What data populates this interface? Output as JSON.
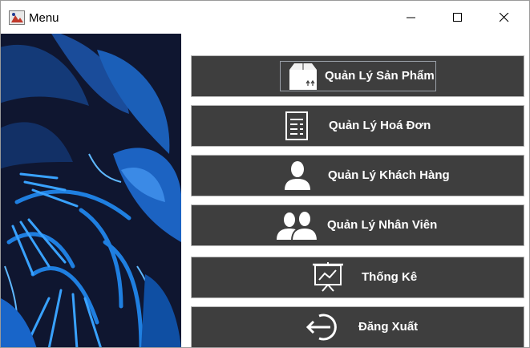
{
  "window": {
    "title": "Menu"
  },
  "menu": {
    "items": [
      {
        "label": "Quản Lý Sản Phẩm",
        "icon": "box-icon"
      },
      {
        "label": "Quản Lý Hoá Đơn",
        "icon": "invoice-icon"
      },
      {
        "label": "Quản Lý Khách Hàng",
        "icon": "user-icon"
      },
      {
        "label": "Quản Lý Nhân Viên",
        "icon": "users-icon"
      },
      {
        "label": "Thống Kê",
        "icon": "chart-board-icon"
      },
      {
        "label": "Đăng Xuất",
        "icon": "logout-icon"
      }
    ]
  },
  "colors": {
    "button_bg": "#3e3e3e",
    "button_text": "#ffffff",
    "side_image_dark": "#101830",
    "side_image_blue": "#1b6fd6"
  }
}
